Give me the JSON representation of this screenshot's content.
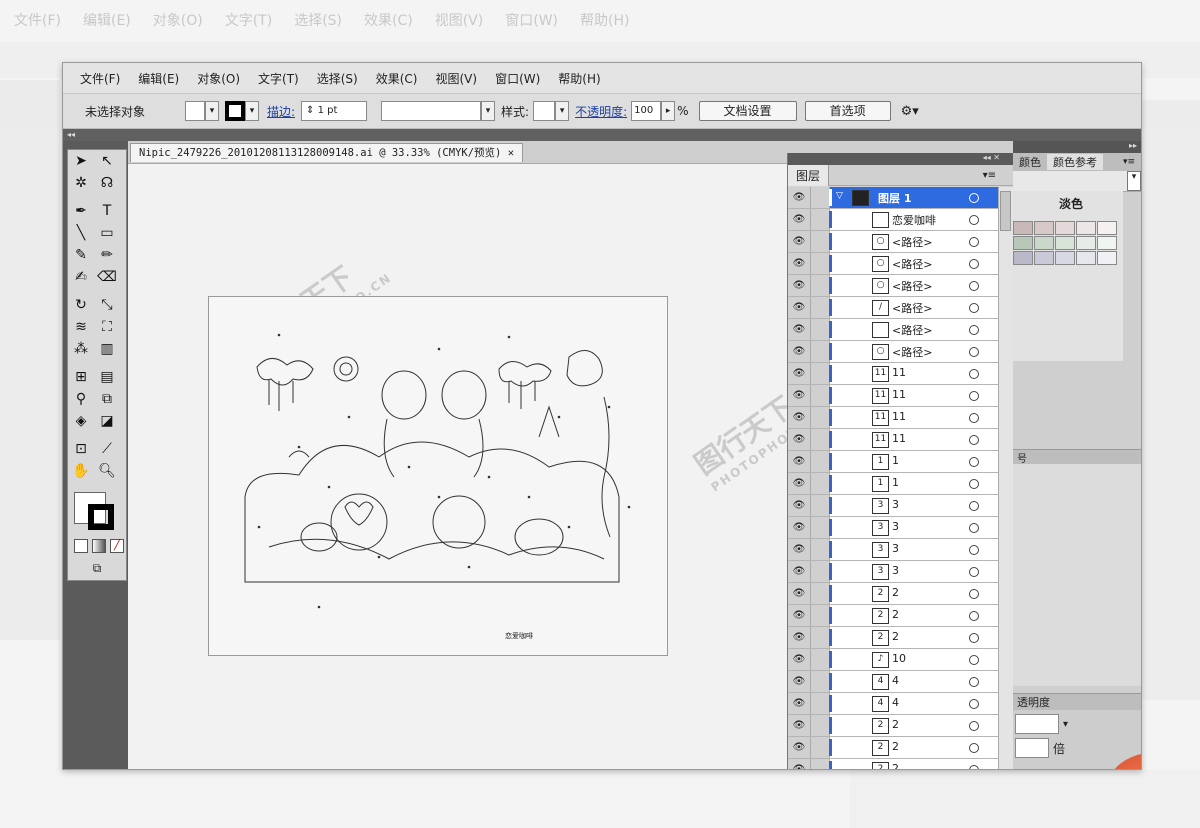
{
  "menu": [
    "文件(F)",
    "编辑(E)",
    "对象(O)",
    "文字(T)",
    "选择(S)",
    "效果(C)",
    "视图(V)",
    "窗口(W)",
    "帮助(H)"
  ],
  "control": {
    "selection": "未选择对象",
    "stroke_label": "描边:",
    "stroke_value": "1 pt",
    "style_label": "样式:",
    "opacity_label": "不透明度:",
    "opacity_value": "100",
    "opacity_unit": "%",
    "doc_setup": "文档设置",
    "prefs": "首选项"
  },
  "document_tab": "Nipic_2479226_20101208113128009148.ai @ 33.33% (CMYK/预览)",
  "artboard_caption": "恋爱咖啡",
  "layers_panel": {
    "title": "图层",
    "top_layer": "图层 1",
    "rows": [
      {
        "thumb": "",
        "name": "恋爱咖啡"
      },
      {
        "thumb": "○",
        "name": "<路径>"
      },
      {
        "thumb": "○",
        "name": "<路径>"
      },
      {
        "thumb": "○",
        "name": "<路径>"
      },
      {
        "thumb": "/",
        "name": "<路径>"
      },
      {
        "thumb": "",
        "name": "<路径>"
      },
      {
        "thumb": "○",
        "name": "<路径>"
      },
      {
        "thumb": "11",
        "name": "11"
      },
      {
        "thumb": "11",
        "name": "11"
      },
      {
        "thumb": "11",
        "name": "11"
      },
      {
        "thumb": "11",
        "name": "11"
      },
      {
        "thumb": "1",
        "name": "1"
      },
      {
        "thumb": "1",
        "name": "1"
      },
      {
        "thumb": "3",
        "name": "3"
      },
      {
        "thumb": "3",
        "name": "3"
      },
      {
        "thumb": "3",
        "name": "3"
      },
      {
        "thumb": "3",
        "name": "3"
      },
      {
        "thumb": "2",
        "name": "2"
      },
      {
        "thumb": "2",
        "name": "2"
      },
      {
        "thumb": "2",
        "name": "2"
      },
      {
        "thumb": "♪",
        "name": "10"
      },
      {
        "thumb": "4",
        "name": "4"
      },
      {
        "thumb": "4",
        "name": "4"
      },
      {
        "thumb": "2",
        "name": "2"
      },
      {
        "thumb": "2",
        "name": "2"
      },
      {
        "thumb": "2",
        "name": "2"
      },
      {
        "thumb": "2",
        "name": "2"
      }
    ]
  },
  "right_panel": {
    "tab1": "颜色",
    "tab2": "颜色参考",
    "swatch_label": "淡色",
    "transparency_label": "透明度",
    "ratio_label": "倍"
  },
  "watermark": {
    "cn": "图行天下",
    "en": "PHOTOPHOTO.CN"
  },
  "colors": {
    "accent": "#2f6be0",
    "toolbox": "#5b5b5b"
  }
}
